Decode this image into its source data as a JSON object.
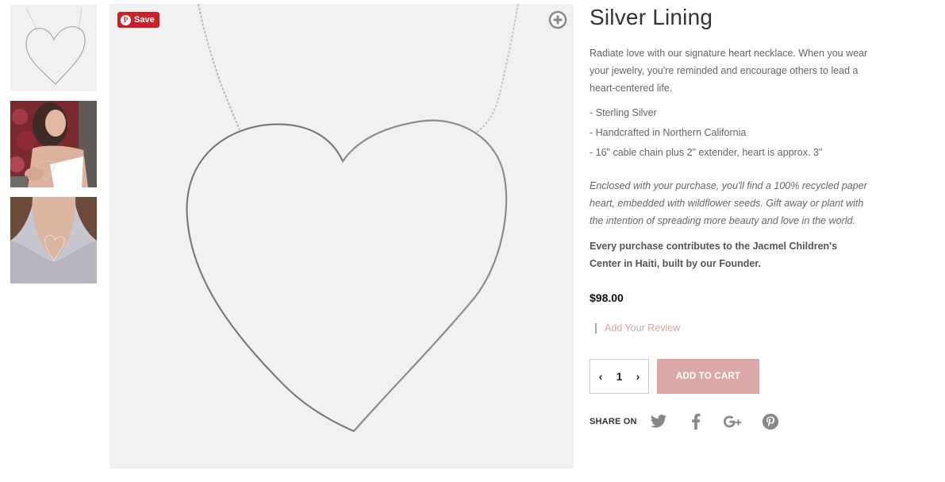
{
  "gallery": {
    "thumbnails": [
      {
        "alt": "heart-necklace-product"
      },
      {
        "alt": "model-wearing-necklace"
      },
      {
        "alt": "necklace-on-sweater"
      }
    ],
    "pin_button_label": "Save",
    "icons": {
      "zoom": "zoom-plus-icon",
      "pin": "pinterest-p-icon"
    }
  },
  "product": {
    "title": "Silver Lining",
    "description": "Radiate love with our signature heart necklace. When you wear your jewelry, you're reminded and encourage others to lead a heart-centered life.",
    "features": [
      "- Sterling Silver",
      "- Handcrafted in Northern California",
      "- 16\" cable chain plus 2\" extender, heart is approx. 3\""
    ],
    "gift_note": "Enclosed with your purchase, you'll find a 100% recycled paper heart, embedded with wildflower seeds. Gift away or plant with the intention of spreading more beauty and love in the world.",
    "charity_note": "Every purchase contributes to the Jacmel Children's Center in Haiti, built by our Founder.",
    "price": "$98.00",
    "review_link": "Add Your Review"
  },
  "cart": {
    "quantity": "1",
    "decrement_symbol": "‹",
    "increment_symbol": "›",
    "add_to_cart_label": "ADD TO CART"
  },
  "share": {
    "label": "SHARE ON",
    "networks": [
      "twitter-icon",
      "facebook-icon",
      "google-plus-icon",
      "pinterest-icon"
    ]
  },
  "colors": {
    "accent": "#dba7a7",
    "review_link": "#d9a3a4",
    "pinterest_red": "#cb2027",
    "icon_gray": "#888888"
  }
}
